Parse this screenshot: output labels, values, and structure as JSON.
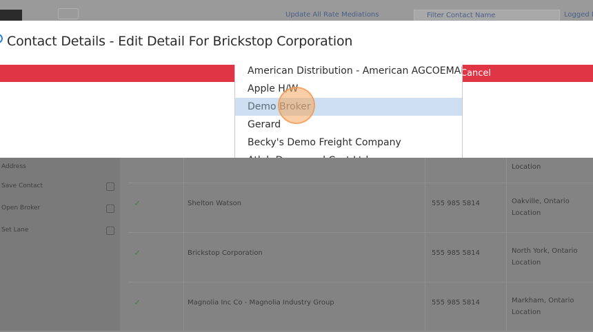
{
  "background": {
    "top_links": [
      "Update All Rate Mediations",
      "Filter Contact Name",
      "Logged In"
    ],
    "sidebar": [
      "Address",
      "Save Contact",
      "Open Broker",
      "Set Lane",
      "",
      "",
      "",
      ""
    ],
    "rows": [
      {
        "name": "",
        "phone": "",
        "loc1": "",
        "loc2": "Location"
      },
      {
        "name": "Shelton Watson",
        "phone": "555 985 5814",
        "loc1": "Oakville, Ontario",
        "loc2": "Location"
      },
      {
        "name": "Brickstop Corporation",
        "phone": "555 985 5814",
        "loc1": "North York, Ontario",
        "loc2": "Location"
      },
      {
        "name": "Magnolia Inc Co - Magnolia Industry Group",
        "phone": "555 985 5814",
        "loc1": "Markham, Ontario",
        "loc2": "Location"
      }
    ],
    "check_glyph": "✓"
  },
  "modal": {
    "title": "Contact Details - Edit Detail For Brickstop Corporation",
    "cancel_label": "Cancel",
    "accent_color": "#e03545"
  },
  "dropdown": {
    "options": [
      "American Distribution - American AGCOEMAI",
      "Apple H/W",
      "Demo Broker",
      "Gerard",
      "Becky's Demo Freight Company",
      "Atlab Demo and Cost Ltd"
    ],
    "selected": "Demo Broker",
    "highlight_color": "#cddff0"
  }
}
